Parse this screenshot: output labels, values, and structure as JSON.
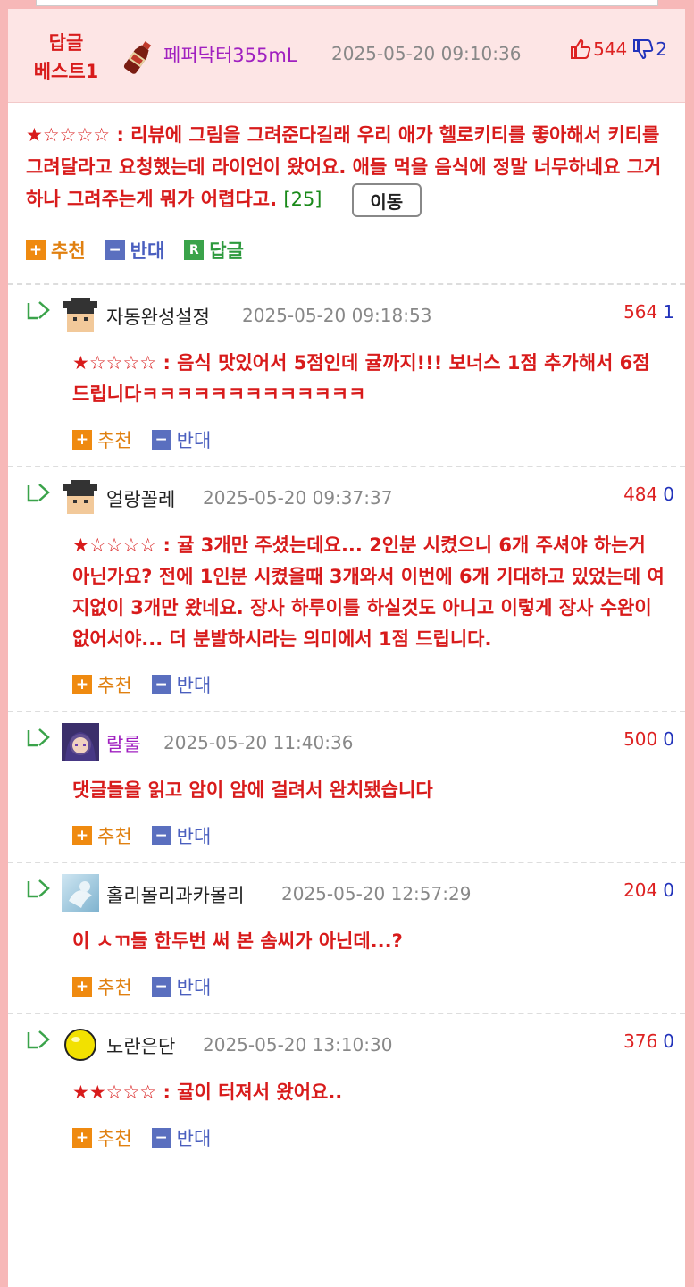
{
  "best": {
    "label_line1": "답글",
    "label_line2": "베스트1",
    "nickname": "페퍼닥터355mL",
    "datetime": "2025-05-20 09:10:36",
    "up": "544",
    "down": "2",
    "text": "★☆☆☆☆ : 리뷰에 그림을 그려준다길래 우리 애가 헬로키티를 좋아해서 키티를 그려달라고 요청했는데 라이언이 왔어요. 애들 먹을 음식에 정말 너무하네요 그거 하나 그려주는게 뭐가 어렵다고.",
    "count": "[25]",
    "move_label": "이동"
  },
  "labels": {
    "recommend": "추천",
    "oppose": "반대",
    "reply": "답글",
    "reply_icon": "R",
    "plus": "+",
    "minus": "−"
  },
  "comments": [
    {
      "nickname": "자동완성설정",
      "datetime": "2025-05-20 09:18:53",
      "up": "564",
      "down": "1",
      "avatar": "graduate-avatar",
      "text": "★☆☆☆☆ : 음식 맛있어서 5점인데 귤까지!!! 보너스 1점 추가해서 6점 드립니다ㅋㅋㅋㅋㅋㅋㅋㅋㅋㅋㅋㅋㅋ"
    },
    {
      "nickname": "얼랑꼴레",
      "datetime": "2025-05-20 09:37:37",
      "up": "484",
      "down": "0",
      "avatar": "graduate-avatar",
      "text": "★☆☆☆☆ : 귤 3개만 주셨는데요... 2인분 시켰으니 6개 주셔야 하는거 아닌가요? 전에 1인분 시켰을때 3개와서 이번에 6개 기대하고 있었는데 여지없이 3개만 왔네요. 장사 하루이틀 하실것도 아니고 이렇게 장사 수완이 없어서야... 더 분발하시라는 의미에서 1점 드립니다."
    },
    {
      "nickname": "랄룰",
      "datetime": "2025-05-20 11:40:36",
      "up": "500",
      "down": "0",
      "avatar": "anime-avatar",
      "text": "댓글들을 읽고 암이 암에 걸려서 완치됐습니다"
    },
    {
      "nickname": "홀리몰리과카몰리",
      "datetime": "2025-05-20 12:57:29",
      "up": "204",
      "down": "0",
      "avatar": "sky-avatar",
      "text": "이 ㅅㄲ들 한두번 써 본 솜씨가 아닌데...?"
    },
    {
      "nickname": "노란은단",
      "datetime": "2025-05-20 13:10:30",
      "up": "376",
      "down": "0",
      "avatar": "yellow-ball-avatar",
      "text": "★★☆☆☆ : 귤이 터져서 왔어요.."
    }
  ],
  "colors": {
    "accent_red": "#d81b1b",
    "recommend_orange": "#ef8a10",
    "oppose_blue": "#5a6fbf",
    "reply_green": "#3aa34a"
  }
}
